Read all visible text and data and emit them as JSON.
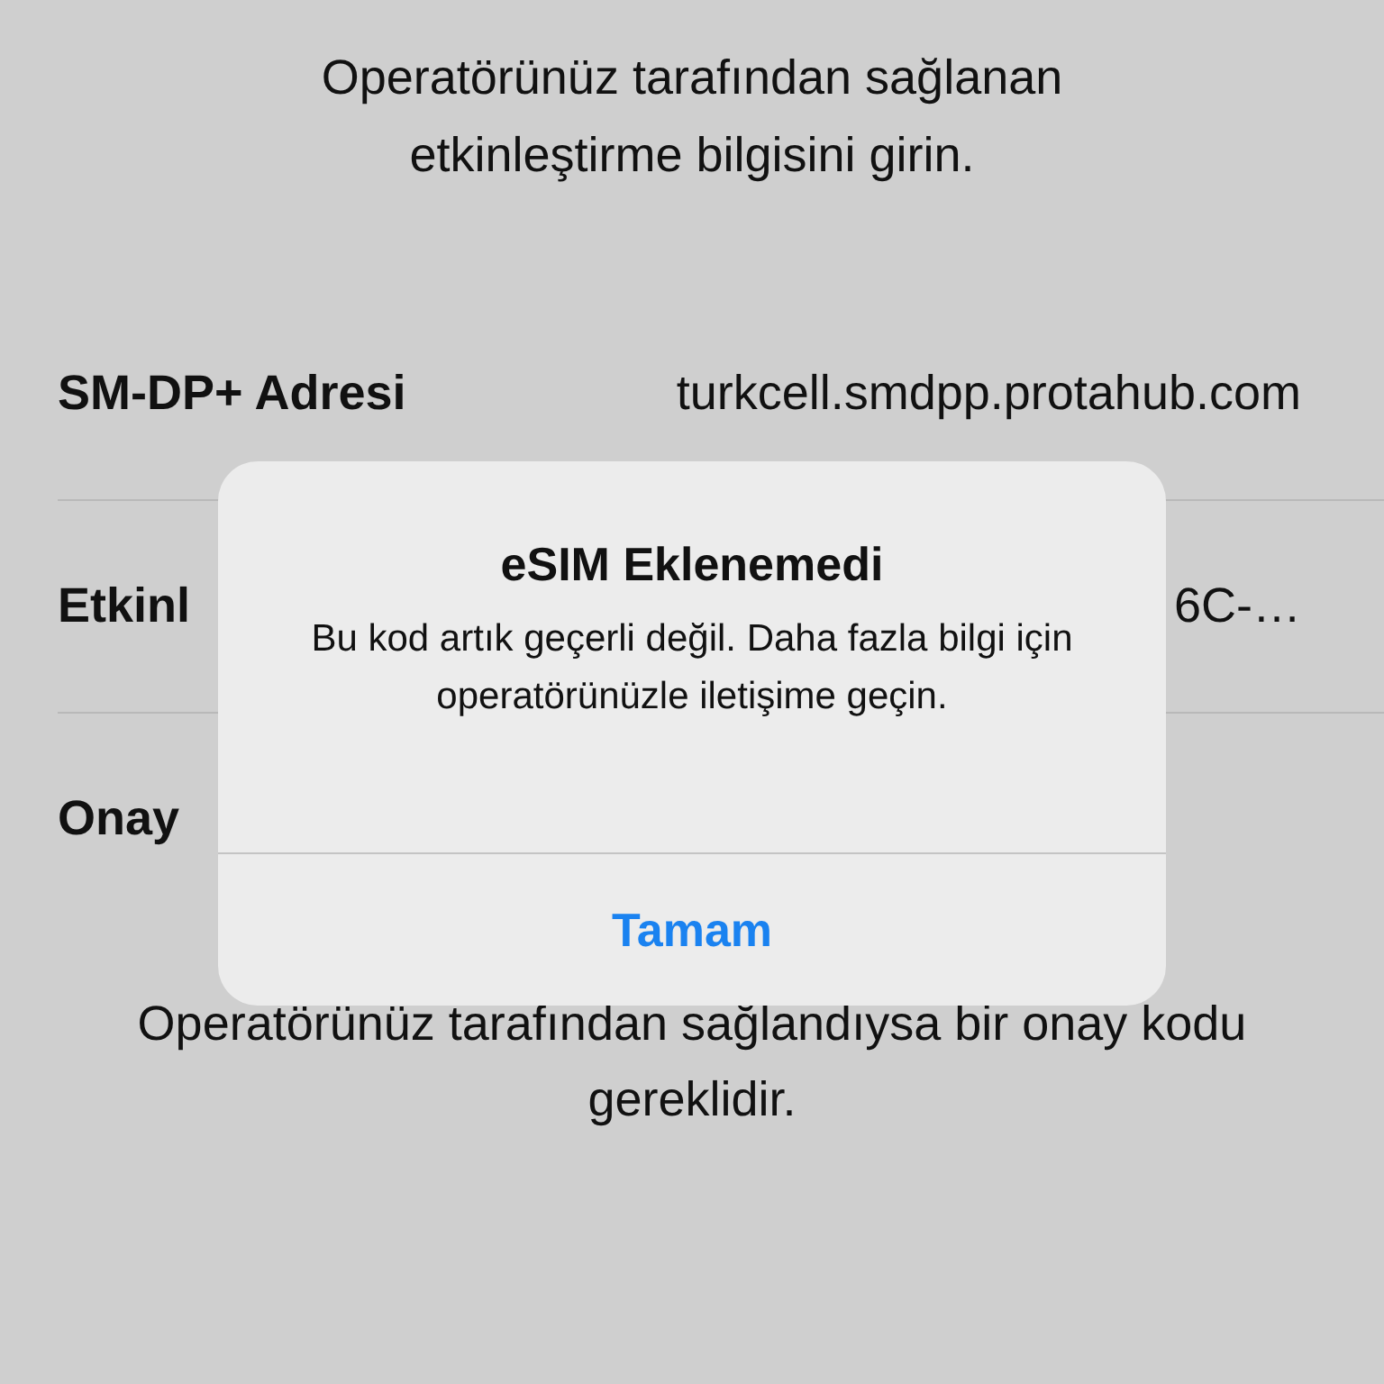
{
  "instructions": "Operatörünüz tarafından sağlanan etkinleştirme bilgisini girin.",
  "fields": [
    {
      "label": "SM-DP+ Adresi",
      "value": "turkcell.smdpp.protahub.com"
    },
    {
      "label": "Etkinl",
      "value": "6C-…"
    },
    {
      "label": "Onay"
    }
  ],
  "footer": "Operatörünüz tarafından sağlandıysa bir onay kodu gereklidir.",
  "alert": {
    "title": "eSIM Eklenemedi",
    "message": "Bu kod artık geçerli değil. Daha fazla bilgi için operatörünüzle iletişime geçin.",
    "button": "Tamam"
  }
}
